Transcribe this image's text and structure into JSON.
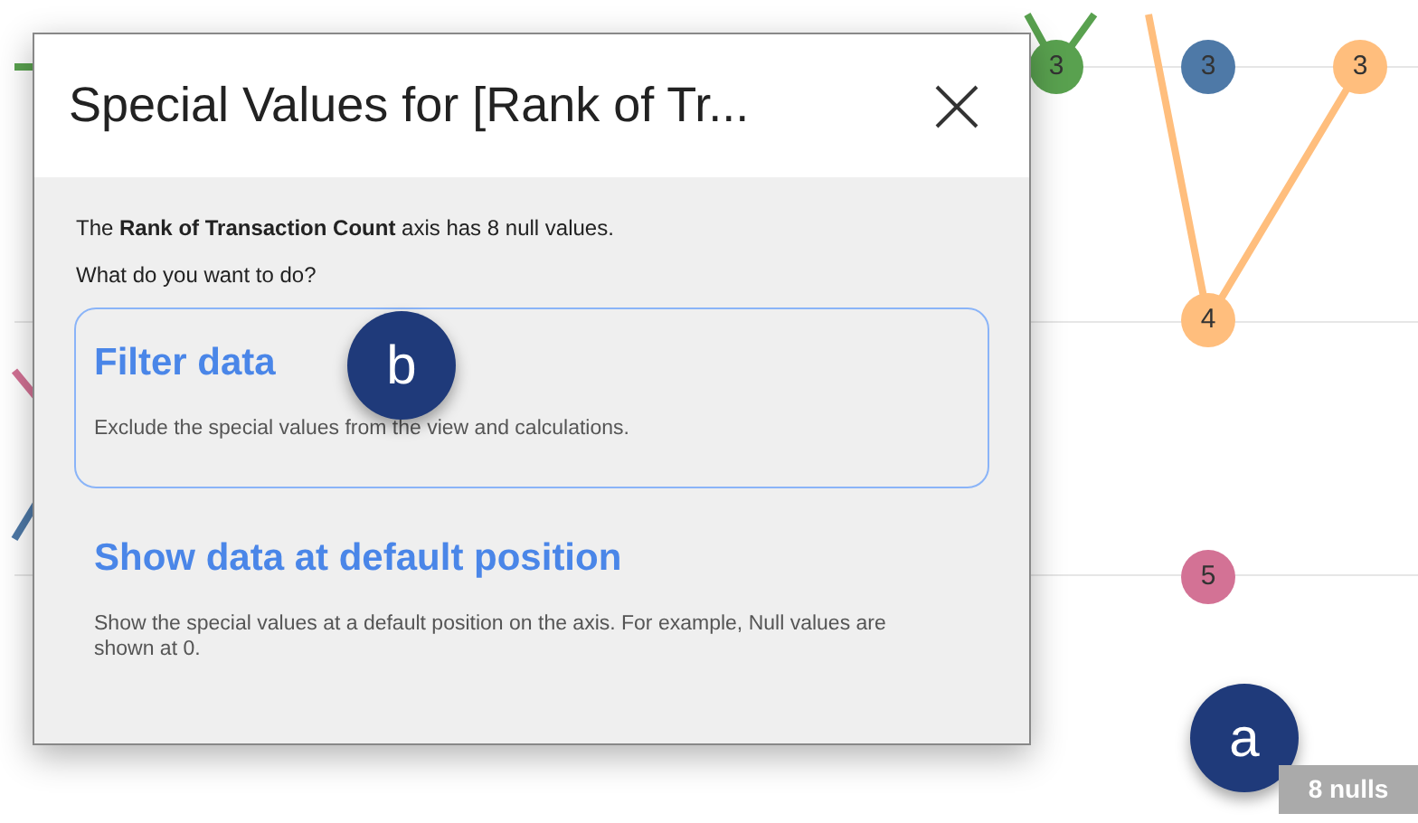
{
  "chart": {
    "markers": [
      {
        "label": "3",
        "color": "#59a14f"
      },
      {
        "label": "3",
        "color": "#4e79a7"
      },
      {
        "label": "3",
        "color": "#ffbe7d"
      },
      {
        "label": "4",
        "color": "#ffbe7d"
      },
      {
        "label": "5",
        "color": "#d37295"
      }
    ]
  },
  "dialog": {
    "title": "Special Values for [Rank of Tr...",
    "message": "The **Rank of Transaction Count** axis has 8 null values.",
    "question": "What do you want to do?",
    "options": [
      {
        "title": "Filter data",
        "description": "Exclude the special values from the view and calculations.",
        "selected": true
      },
      {
        "title": "Show data at default position",
        "description": "Show the special values at a default position on the axis. For example, Null values are shown at 0.",
        "selected": false
      }
    ]
  },
  "callouts": [
    {
      "label": "b"
    },
    {
      "label": "a"
    }
  ],
  "null_indicator": "8 nulls"
}
